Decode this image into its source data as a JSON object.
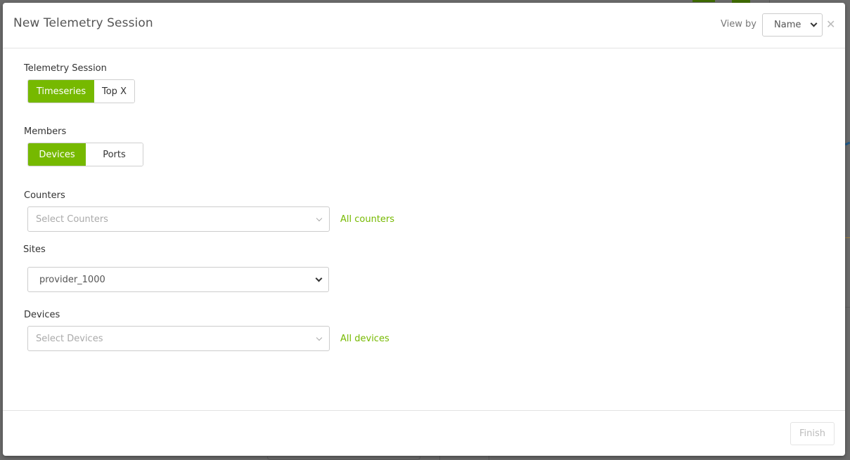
{
  "modal": {
    "title": "New Telemetry Session",
    "view_by": {
      "label": "View by",
      "selected": "Name"
    },
    "close_icon": "close-icon"
  },
  "telemetry_session": {
    "label": "Telemetry Session",
    "options": [
      {
        "label": "Timeseries",
        "active": true
      },
      {
        "label": "Top X",
        "active": false
      }
    ]
  },
  "members": {
    "label": "Members",
    "options": [
      {
        "label": "Devices",
        "active": true
      },
      {
        "label": "Ports",
        "active": false
      }
    ]
  },
  "counters": {
    "label": "Counters",
    "placeholder": "Select Counters",
    "link": "All counters"
  },
  "sites": {
    "label": "Sites",
    "selected": "provider_1000"
  },
  "devices": {
    "label": "Devices",
    "placeholder": "Select Devices",
    "link": "All devices"
  },
  "footer": {
    "finish_label": "Finish",
    "finish_enabled": false
  },
  "colors": {
    "accent": "#76b900",
    "overlay": "#6b6b6b",
    "disabled_text": "#bbbbbb"
  }
}
